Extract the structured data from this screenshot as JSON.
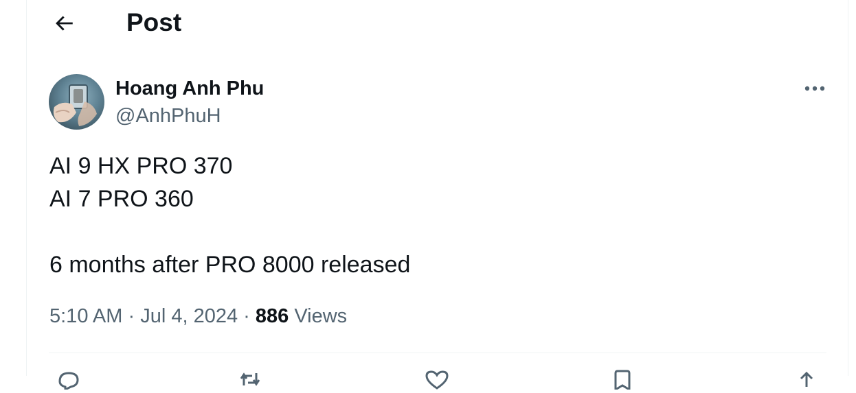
{
  "header": {
    "back_icon": "arrow-left-icon",
    "title": "Post"
  },
  "author": {
    "name": "Hoang Anh Phu",
    "handle": "@AnhPhuH",
    "avatar_icon": "avatar"
  },
  "tweet": {
    "text": "AI 9 HX PRO 370\nAI 7 PRO 360\n\n6 months after PRO 8000 released",
    "time": "5:10 AM",
    "date": "Jul 4, 2024",
    "separator": "·",
    "views_count": "886",
    "views_label": "Views"
  },
  "actions": {
    "icons": [
      "reply-icon",
      "retweet-icon",
      "like-icon",
      "bookmark-icon",
      "share-icon"
    ]
  },
  "colors": {
    "primary_text": "#0f1419",
    "secondary_text": "#536471",
    "border": "#eff3f4"
  }
}
